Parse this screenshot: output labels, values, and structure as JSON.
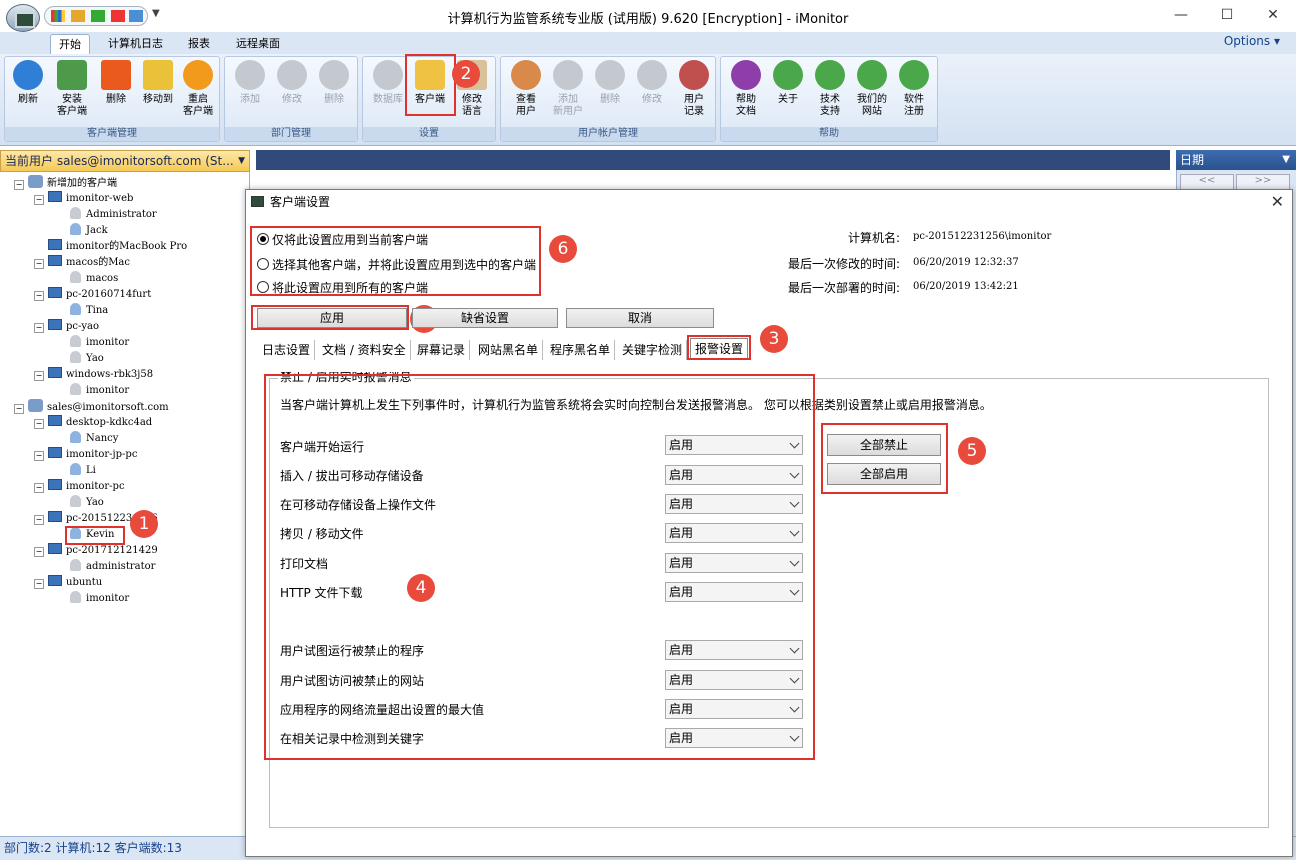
{
  "window": {
    "title": "计算机行为监管系统专业版 (试用版) 9.620 [Encryption] - iMonitor"
  },
  "ribbon_tabs": [
    "开始",
    "计算机日志",
    "报表",
    "远程桌面"
  ],
  "options_label": "Options",
  "ribbon": {
    "groups": {
      "client": "客户端管理",
      "dept": "部门管理",
      "settings": "设置",
      "account": "用户帐户管理",
      "help": "帮助"
    },
    "buttons": {
      "refresh": "刷新",
      "install": "安装\n客户端",
      "delete": "删除",
      "move": "移动到",
      "restart": "重启\n客户端",
      "dept_add": "添加",
      "dept_edit": "修改",
      "dept_delete": "删除",
      "database": "数据库",
      "client": "客户端",
      "language": "修改\n语言",
      "view_user": "查看\n用户",
      "add_user": "添加\n新用户",
      "user_delete": "删除",
      "user_edit": "修改",
      "user_log": "用户\n记录",
      "help_doc": "帮助\n文档",
      "about": "关于",
      "support": "技术\n支持",
      "website": "我们的\n网站",
      "register": "软件\n注册"
    }
  },
  "left_pane": {
    "header": "当前用户 sales@imonitorsoft.com (St...",
    "tree": [
      {
        "label": "新增加的客户端"
      },
      {
        "label": "imonitor-web"
      },
      {
        "label": "Administrator"
      },
      {
        "label": "Jack"
      },
      {
        "label": "imonitor的MacBook Pro"
      },
      {
        "label": "macos的Mac"
      },
      {
        "label": "macos"
      },
      {
        "label": "pc-20160714furt"
      },
      {
        "label": "Tina"
      },
      {
        "label": "pc-yao"
      },
      {
        "label": "imonitor"
      },
      {
        "label": "Yao"
      },
      {
        "label": "windows-rbk3j58"
      },
      {
        "label": "imonitor"
      },
      {
        "label": "sales@imonitorsoft.com"
      },
      {
        "label": "desktop-kdkc4ad"
      },
      {
        "label": "Nancy"
      },
      {
        "label": "imonitor-jp-pc"
      },
      {
        "label": "Li"
      },
      {
        "label": "imonitor-pc"
      },
      {
        "label": "Yao"
      },
      {
        "label": "pc-201512231256"
      },
      {
        "label": "Kevin"
      },
      {
        "label": "pc-201712121429"
      },
      {
        "label": "administrator"
      },
      {
        "label": "ubuntu"
      },
      {
        "label": "imonitor"
      }
    ]
  },
  "right_pane": {
    "header": "日期"
  },
  "status": {
    "text": "部门数:2 计算机:12 客户端数:13"
  },
  "dialog": {
    "title": "客户端设置",
    "apply_options": [
      "仅将此设置应用到当前客户端",
      "选择其他客户端，并将此设置应用到选中的客户端",
      "将此设置应用到所有的客户端"
    ],
    "info": {
      "computer_label": "计算机名:",
      "computer_value": "pc-201512231256\\imonitor",
      "modified_label": "最后一次修改的时间:",
      "modified_value": "06/20/2019 12:32:37",
      "deployed_label": "最后一次部署的时间:",
      "deployed_value": "06/20/2019 13:42:21"
    },
    "buttons": {
      "apply": "应用",
      "default": "缺省设置",
      "cancel": "取消",
      "disable_all": "全部禁止",
      "enable_all": "全部启用"
    },
    "tabs": [
      "日志设置",
      "文档 / 资料安全",
      "屏幕记录",
      "网站黑名单",
      "程序黑名单",
      "关键字检测",
      "报警设置"
    ],
    "group_caption": "禁止 / 启用实时报警消息",
    "intro": "当客户端计算机上发生下列事件时，计算机行为监管系统将会实时向控制台发送报警消息。 您可以根据类别设置禁止或启用报警消息。",
    "events": [
      {
        "label": "客户端开始运行",
        "value": "启用"
      },
      {
        "label": "插入 / 拔出可移动存储设备",
        "value": "启用"
      },
      {
        "label": "在可移动存储设备上操作文件",
        "value": "启用"
      },
      {
        "label": "拷贝 / 移动文件",
        "value": "启用"
      },
      {
        "label": "打印文档",
        "value": "启用"
      },
      {
        "label": "HTTP 文件下载",
        "value": "启用"
      },
      {
        "label": "用户试图运行被禁止的程序",
        "value": "启用"
      },
      {
        "label": "用户试图访问被禁止的网站",
        "value": "启用"
      },
      {
        "label": "应用程序的网络流量超出设置的最大值",
        "value": "启用"
      },
      {
        "label": "在相关记录中检测到关键字",
        "value": "启用"
      }
    ]
  },
  "annotations": [
    "1",
    "2",
    "3",
    "4",
    "5",
    "6",
    "7"
  ],
  "colors": {
    "annotation_red": "#e0322c",
    "ribbon_blue": "#dbe6f4",
    "header_gold": "#f6c955"
  }
}
